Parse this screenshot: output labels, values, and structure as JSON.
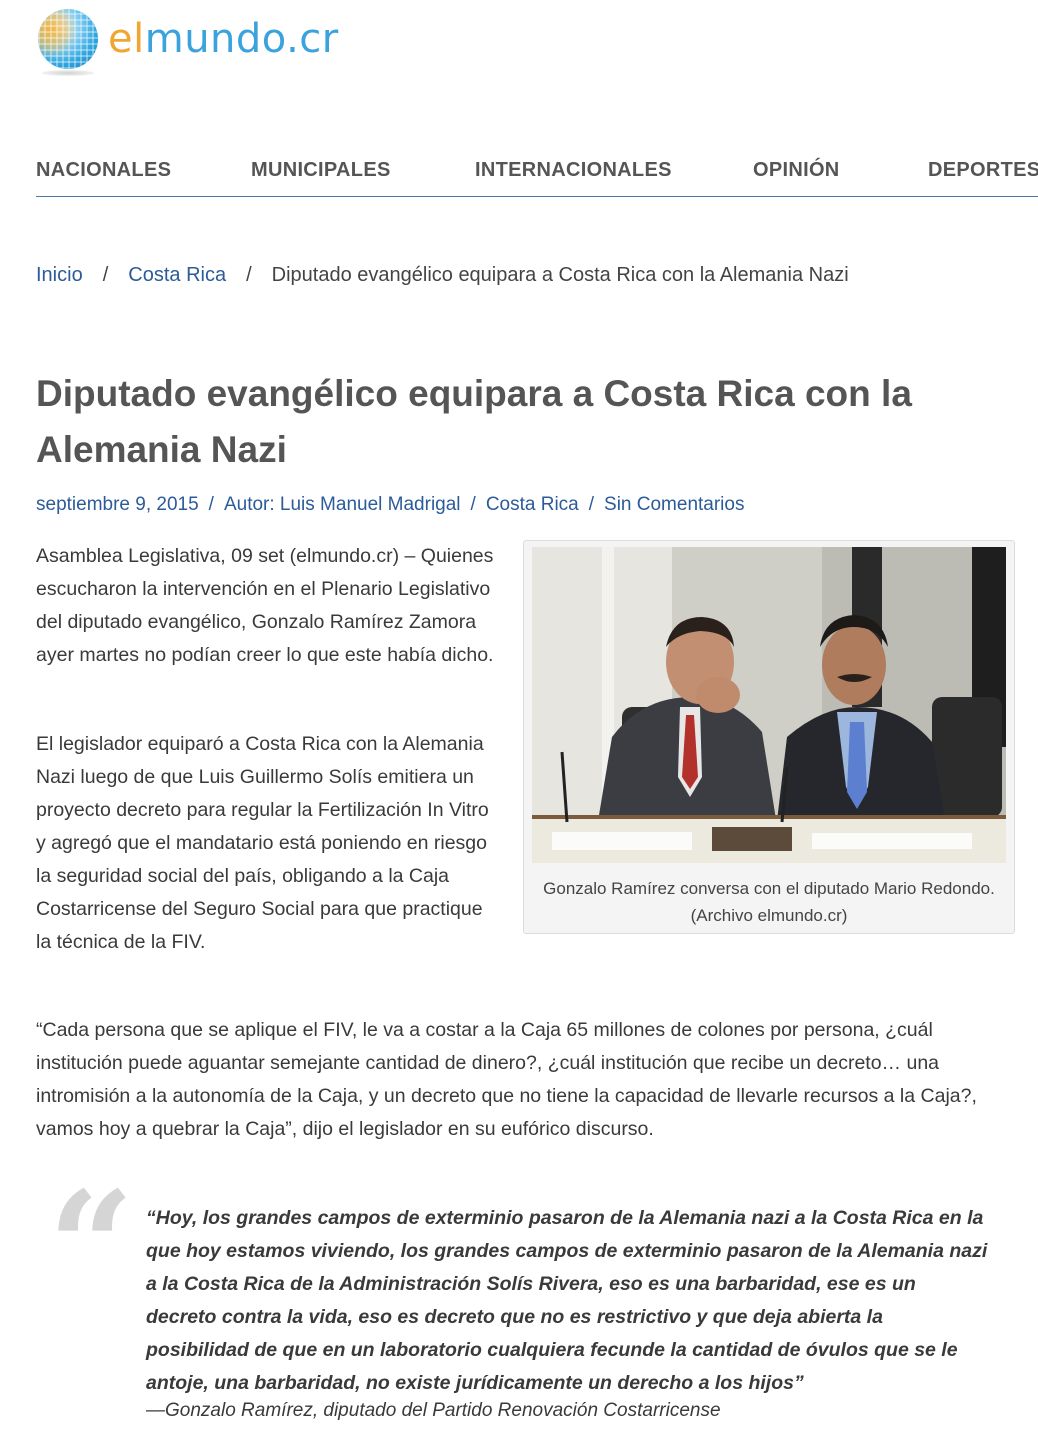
{
  "site": {
    "logo_el": "el",
    "logo_rest": "mundo.cr"
  },
  "nav": {
    "items": [
      "NACIONALES",
      "MUNICIPALES",
      "INTERNACIONALES",
      "OPINIÓN",
      "DEPORTES"
    ]
  },
  "breadcrumb": {
    "home": "Inicio",
    "separator": "/",
    "category": "Costa Rica",
    "current": "Diputado evangélico equipara a Costa Rica con la Alemania Nazi"
  },
  "article": {
    "title": "Diputado evangélico equipara a Costa Rica con la Alemania Nazi",
    "meta": {
      "date": "septiembre 9, 2015",
      "author": "Autor: Luis Manuel Madrigal",
      "category": "Costa Rica",
      "comments": "Sin Comentarios",
      "separator": "/"
    },
    "paragraphs": [
      "Asamblea Legislativa, 09 set (elmundo.cr) – Quienes escucharon la intervención en el Plenario Legislativo del diputado evangélico, Gonzalo Ramírez Zamora ayer martes no podían creer lo que este había dicho.",
      "El legislador equiparó a Costa Rica con la Alemania Nazi luego de que Luis Guillermo Solís emitiera un proyecto decreto para regular la Fertilización In Vitro y agregó que el mandatario está poniendo en riesgo la seguridad social del país, obligando a la Caja Costarricense del Seguro Social para que practique la técnica de la FIV.",
      "“Cada persona que se aplique el FIV, le va a costar a la Caja 65 millones de colones por persona, ¿cuál institución puede aguantar semejante cantidad de dinero?, ¿cuál institución que recibe un decreto… una intromisión a la autonomía de la Caja, y un decreto que no tiene la capacidad de llevarle recursos a la Caja?, vamos hoy a quebrar la Caja”, dijo el legislador en su eufórico discurso."
    ],
    "figure_caption": "Gonzalo Ramírez conversa con el diputado Mario Redondo. (Archivo elmundo.cr)",
    "quote": {
      "mark": "“",
      "text": "“Hoy, los grandes campos de exterminio pasaron de la Alemania nazi a la Costa Rica en la que hoy estamos viviendo, los grandes campos de exterminio pasaron de la Alemania nazi a la Costa Rica de la Administración Solís Rivera, eso es una barbaridad, ese es un decreto contra la vida, eso es decreto que no es restrictivo y que deja abierta la posibilidad de que en un laboratorio cualquiera fecunde la cantidad de óvulos que se le antoje, una barbaridad, no existe jurídicamente un derecho a los hijos”",
      "cite": "—Gonzalo Ramírez, diputado del Partido Renovación Costarricense"
    }
  }
}
